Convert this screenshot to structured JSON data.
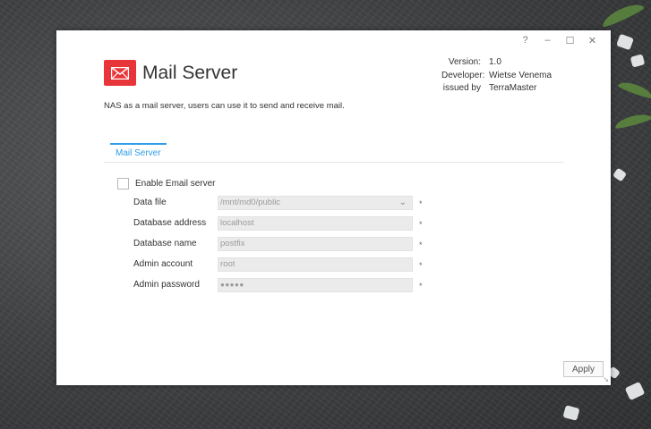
{
  "window": {
    "controls": {
      "help": "?",
      "minimize": "–",
      "maximize": "☐",
      "close": "✕"
    }
  },
  "app": {
    "title": "Mail Server",
    "icon": "envelope-icon",
    "accent_color": "#e8353a",
    "description": "NAS as a mail server, users can use it to send and receive mail."
  },
  "meta": {
    "version_label": "Version:",
    "version_value": "1.0",
    "developer_label": "Developer:",
    "developer_value": "Wietse Venema",
    "issued_label": "issued by",
    "issued_value": "TerraMaster"
  },
  "tabs": [
    {
      "label": "Mail Server",
      "active": true,
      "color": "#2d9de5"
    }
  ],
  "form": {
    "enable_label": "Enable Email server",
    "enable_checked": false,
    "fields": [
      {
        "label": "Data file",
        "value": "/mnt/md0/public",
        "type": "select",
        "required": "*"
      },
      {
        "label": "Database address",
        "value": "localhost",
        "type": "text",
        "required": "*"
      },
      {
        "label": "Database name",
        "value": "postfix",
        "type": "text",
        "required": "*"
      },
      {
        "label": "Admin account",
        "value": "root",
        "type": "text",
        "required": "*"
      },
      {
        "label": "Admin password",
        "value": "●●●●●",
        "type": "password",
        "required": "*"
      }
    ]
  },
  "actions": {
    "apply_label": "Apply"
  }
}
